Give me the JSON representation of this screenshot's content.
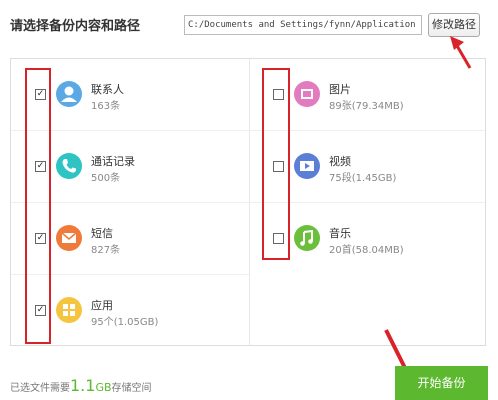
{
  "header": {
    "title": "请选择备份内容和路径",
    "path_value": "C:/Documents and Settings/fynn/Application Data",
    "change_path_label": "修改路径"
  },
  "items": [
    {
      "name": "联系人",
      "count": "163条",
      "checked": true,
      "icon": "contacts-icon",
      "color": "#5aa9e6"
    },
    {
      "name": "通话记录",
      "count": "500条",
      "checked": true,
      "icon": "phone-icon",
      "color": "#2ec4c4"
    },
    {
      "name": "短信",
      "count": "827条",
      "checked": true,
      "icon": "message-icon",
      "color": "#f07a3a"
    },
    {
      "name": "应用",
      "count": "95个(1.05GB)",
      "checked": true,
      "icon": "apps-icon",
      "color": "#f5c542"
    },
    {
      "name": "图片",
      "count": "89张(79.34MB)",
      "checked": false,
      "icon": "pictures-icon",
      "color": "#e27bbf"
    },
    {
      "name": "视频",
      "count": "75段(1.45GB)",
      "checked": false,
      "icon": "video-icon",
      "color": "#5b7fd6"
    },
    {
      "name": "音乐",
      "count": "20首(58.04MB)",
      "checked": false,
      "icon": "music-icon",
      "color": "#6bbf3a"
    }
  ],
  "footer": {
    "prefix": "已选文件需要",
    "size": "1.1",
    "unit": "GB",
    "suffix": "存储空间",
    "start_label": "开始备份"
  },
  "accent_color": "#5cb82e",
  "annotation_color": "#d9232b"
}
